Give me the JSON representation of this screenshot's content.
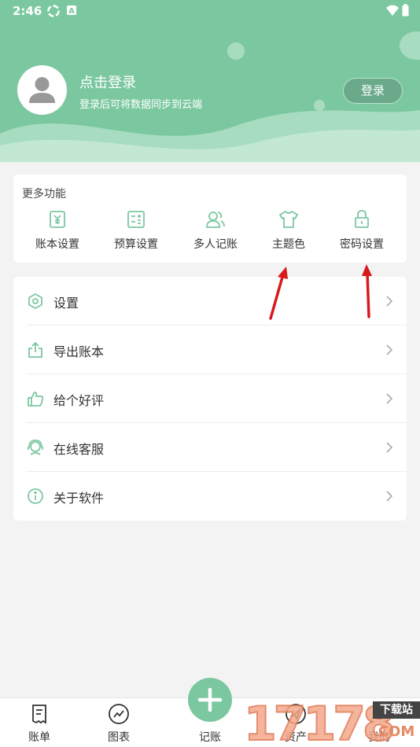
{
  "status_bar": {
    "time": "2:46"
  },
  "header": {
    "login_title": "点击登录",
    "login_subtitle": "登录后可将数据同步到云端",
    "login_button": "登录"
  },
  "features": {
    "title": "更多功能",
    "items": [
      {
        "label": "账本设置",
        "icon": "yen-book-icon"
      },
      {
        "label": "预算设置",
        "icon": "budget-icon"
      },
      {
        "label": "多人记账",
        "icon": "people-icon"
      },
      {
        "label": "主题色",
        "icon": "tshirt-icon"
      },
      {
        "label": "密码设置",
        "icon": "lock-icon"
      }
    ]
  },
  "menu": [
    {
      "label": "设置",
      "icon": "settings-hex-icon"
    },
    {
      "label": "导出账本",
      "icon": "export-icon"
    },
    {
      "label": "给个好评",
      "icon": "thumbs-up-icon"
    },
    {
      "label": "在线客服",
      "icon": "customer-service-icon"
    },
    {
      "label": "关于软件",
      "icon": "info-icon"
    }
  ],
  "bottom_nav": [
    {
      "label": "账单",
      "icon": "bill-icon"
    },
    {
      "label": "图表",
      "icon": "chart-icon"
    },
    {
      "label": "记账",
      "icon": "plus-icon"
    },
    {
      "label": "资产",
      "icon": "assets-icon"
    },
    {
      "label": "我的",
      "icon": "profile-icon"
    }
  ],
  "watermark": {
    "number": "17178",
    "site": "下载站",
    "domain": ".COM"
  },
  "colors": {
    "accent": "#7bc8a0",
    "accent_dark": "#6aaa8a",
    "arrow": "#d8191c"
  }
}
